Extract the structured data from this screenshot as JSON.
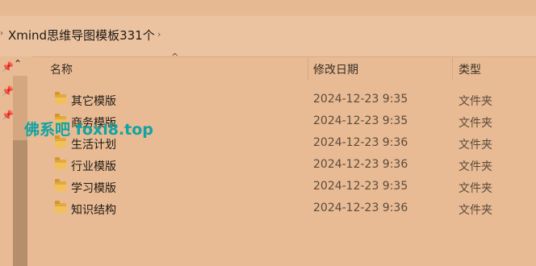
{
  "breadcrumb": {
    "current": "Xmind思维导图模板331个"
  },
  "columns": {
    "name": "名称",
    "date": "修改日期",
    "type": "类型"
  },
  "files": [
    {
      "name": "其它模版",
      "date": "2024-12-23 9:35",
      "type": "文件夹"
    },
    {
      "name": "商务模版",
      "date": "2024-12-23 9:35",
      "type": "文件夹"
    },
    {
      "name": "生活计划",
      "date": "2024-12-23 9:36",
      "type": "文件夹"
    },
    {
      "name": "行业模版",
      "date": "2024-12-23 9:36",
      "type": "文件夹"
    },
    {
      "name": "学习模版",
      "date": "2024-12-23 9:35",
      "type": "文件夹"
    },
    {
      "name": "知识结构",
      "date": "2024-12-23 9:36",
      "type": "文件夹"
    }
  ],
  "watermark": "佛系吧 foxi8.top",
  "icons": {
    "folder": "folder-icon",
    "pin": "pin-icon",
    "sort": "sort-ascending-icon",
    "chevron": "chevron-right-icon"
  }
}
